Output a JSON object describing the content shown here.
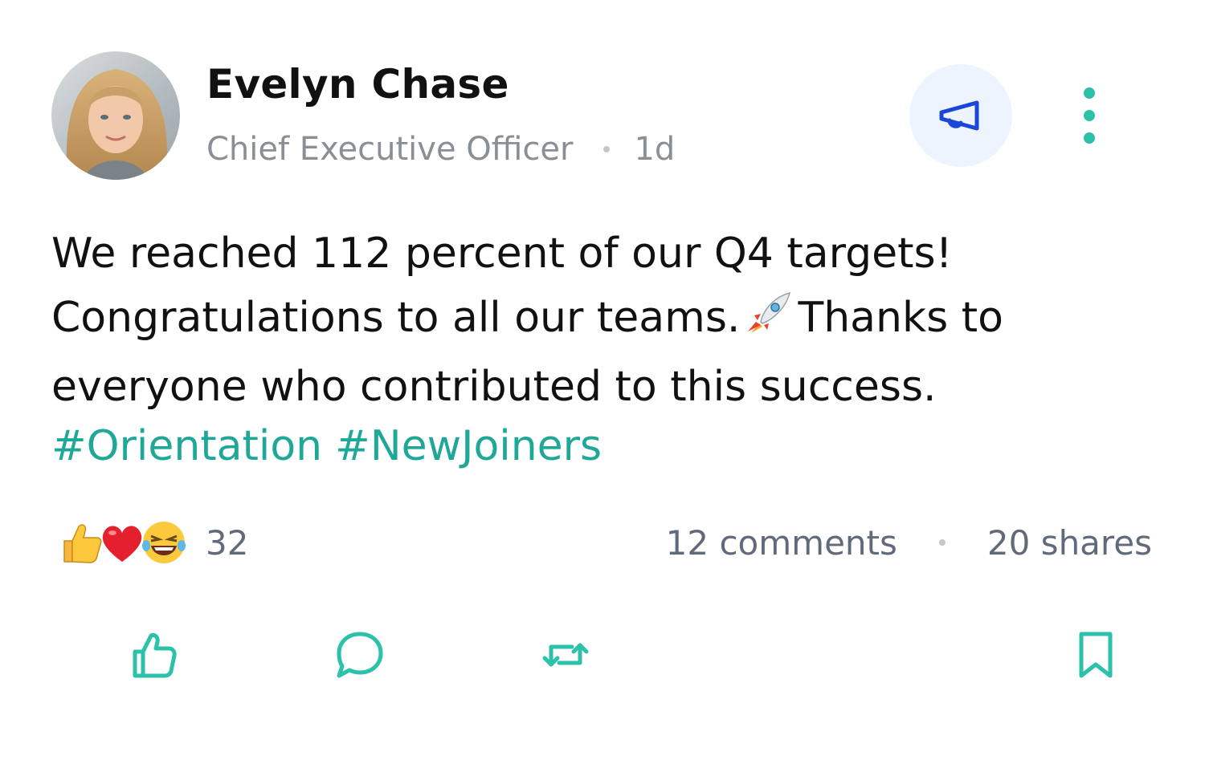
{
  "author": {
    "name": "Evelyn Chase",
    "title": "Chief Executive Officer",
    "time_ago": "1d"
  },
  "header_actions": {
    "announce_icon": "megaphone-icon",
    "more_icon": "more-vertical-icon"
  },
  "post": {
    "lines": [
      "We reached 112 percent of our Q4 targets!",
      "Congratulations to all our teams.",
      "Thanks to",
      "everyone who contributed to this success."
    ],
    "inline_emoji": "rocket-icon",
    "hashtags": [
      "#Orientation",
      "#NewJoiners"
    ]
  },
  "stats": {
    "reaction_icons": [
      "thumbs-up-icon",
      "heart-icon",
      "laughing-icon"
    ],
    "reaction_count": "32",
    "comments": "12 comments",
    "shares": "20 shares"
  },
  "actions": {
    "like_icon": "like-icon",
    "comment_icon": "comment-icon",
    "repost_icon": "repost-icon",
    "bookmark_icon": "bookmark-icon"
  },
  "colors": {
    "accent": "#2cc2a9",
    "hashtag": "#1fa898",
    "announce_bg": "#eef4fd",
    "announce_icon": "#1b46d8",
    "muted_text": "#8a8f96",
    "stats_text": "#606a7a"
  }
}
